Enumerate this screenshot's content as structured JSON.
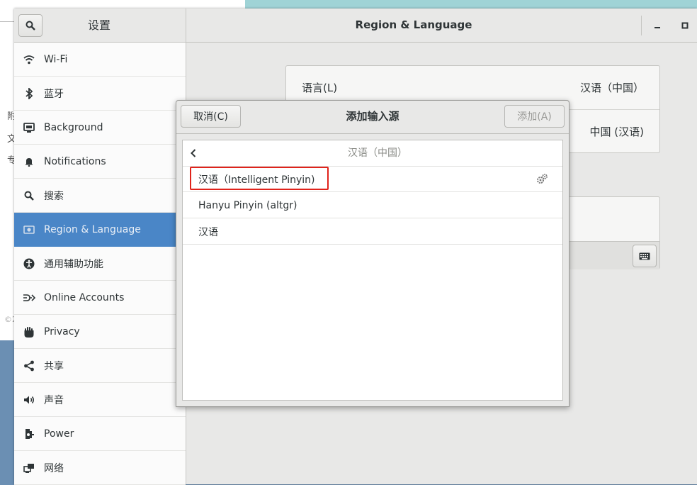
{
  "background": {
    "fragments": [
      "附",
      "文",
      "专"
    ],
    "corner_text": "©2"
  },
  "window": {
    "sidebar_title": "设置",
    "main_title": "Region & Language",
    "controls": {
      "minimize": "minimize-icon",
      "maximize": "maximize-icon"
    }
  },
  "sidebar": {
    "items": [
      {
        "label": "Wi-Fi",
        "icon": "wifi-icon"
      },
      {
        "label": "蓝牙",
        "icon": "bluetooth-icon"
      },
      {
        "label": "Background",
        "icon": "background-icon"
      },
      {
        "label": "Notifications",
        "icon": "bell-icon"
      },
      {
        "label": "搜索",
        "icon": "search-icon"
      },
      {
        "label": "Region & Language",
        "icon": "region-icon",
        "selected": true
      },
      {
        "label": "通用辅助功能",
        "icon": "accessibility-icon"
      },
      {
        "label": "Online Accounts",
        "icon": "online-accounts-icon"
      },
      {
        "label": "Privacy",
        "icon": "hand-icon"
      },
      {
        "label": "共享",
        "icon": "share-icon"
      },
      {
        "label": "声音",
        "icon": "speaker-icon"
      },
      {
        "label": "Power",
        "icon": "power-icon"
      },
      {
        "label": "网络",
        "icon": "network-icon"
      }
    ]
  },
  "content": {
    "language_label": "语言(L)",
    "language_value": "汉语（中国）",
    "formats_value": "中国 (汉语)"
  },
  "dialog": {
    "cancel_label": "取消(C)",
    "title": "添加输入源",
    "add_label": "添加(A)",
    "list_header": "汉语（中国）",
    "items": [
      {
        "label": "汉语（Intelligent Pinyin)",
        "has_settings": true,
        "highlighted": true
      },
      {
        "label": "Hanyu Pinyin (altgr)"
      },
      {
        "label": "汉语"
      }
    ]
  },
  "colors": {
    "selection": "#4a86c7",
    "highlight_box": "#e0231b"
  }
}
